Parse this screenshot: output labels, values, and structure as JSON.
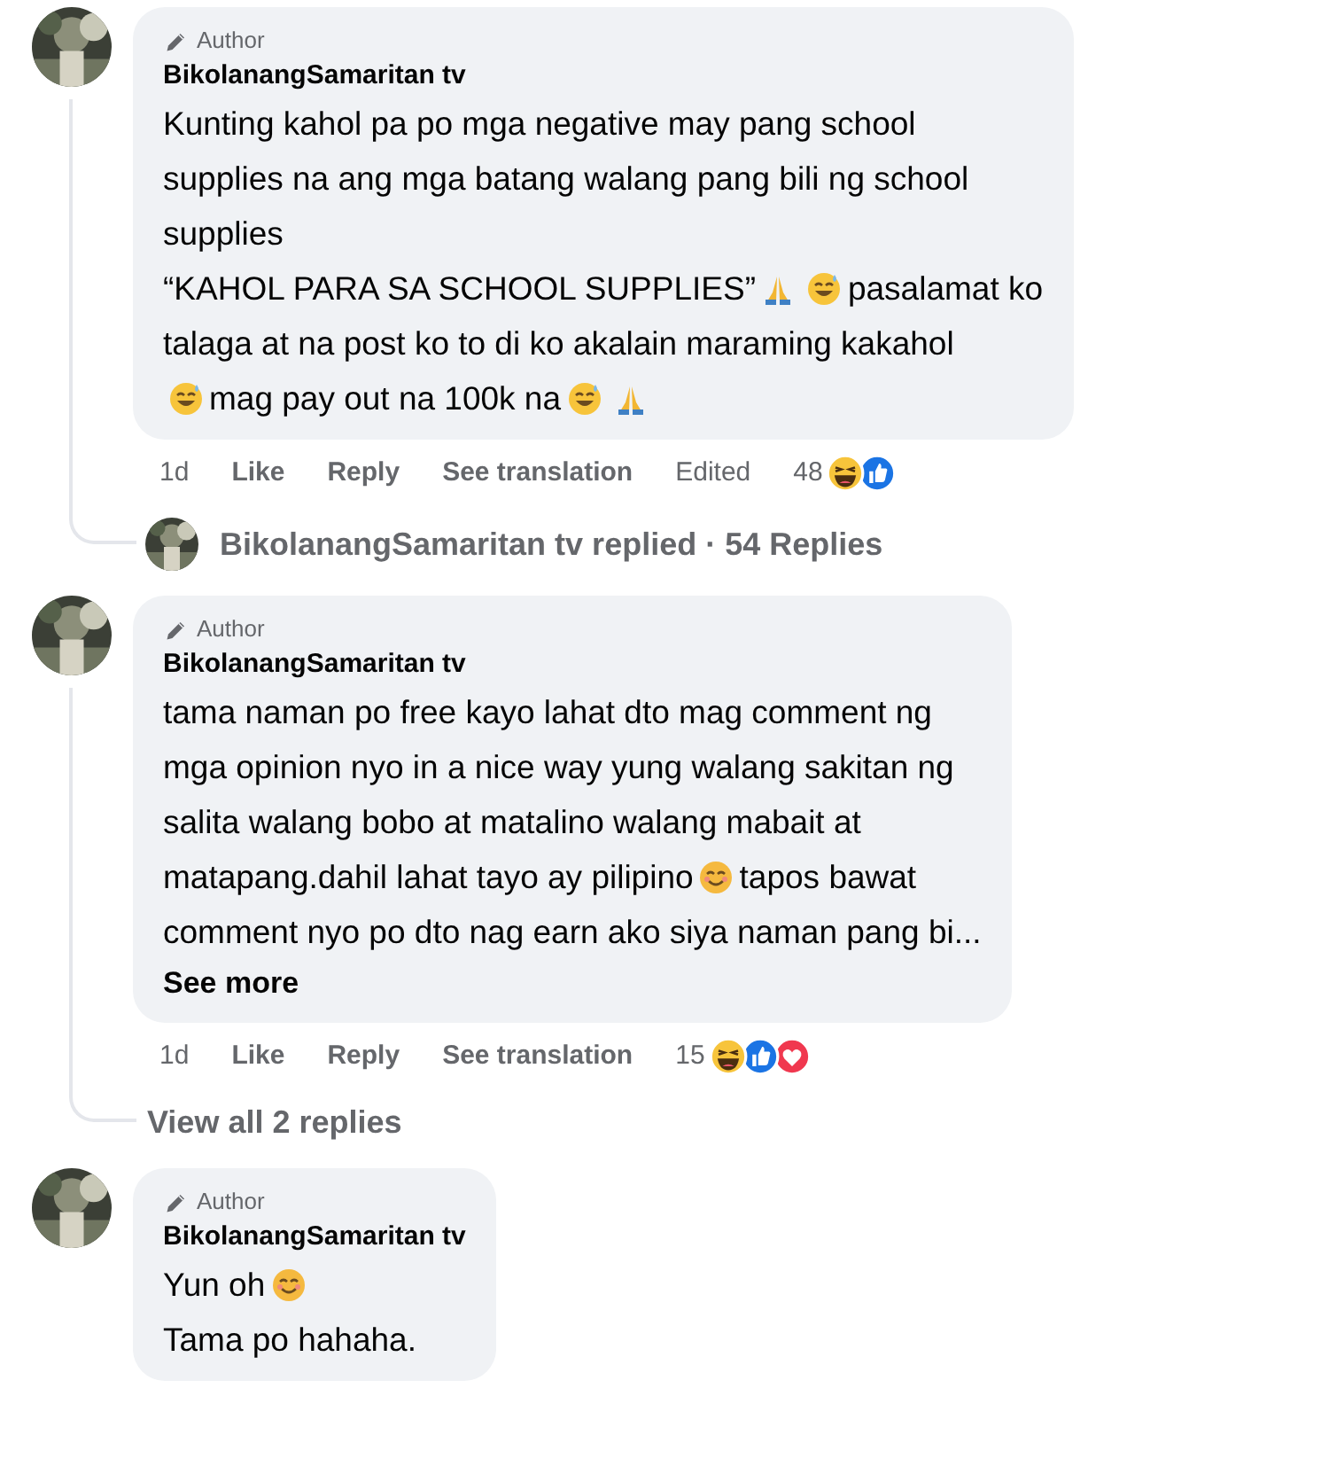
{
  "comments": [
    {
      "badge": "Author",
      "name": "BikolanangSamaritan tv",
      "lines": [
        [
          {
            "kind": "text",
            "text": "Kunting kahol pa po mga negative may pang school"
          }
        ],
        [
          {
            "kind": "text",
            "text": "supplies na ang mga batang walang pang bili ng school"
          }
        ],
        [
          {
            "kind": "text",
            "text": "supplies"
          }
        ],
        [
          {
            "kind": "text",
            "text": "“KAHOL PARA SA SCHOOL SUPPLIES”"
          },
          {
            "kind": "pray"
          },
          {
            "kind": "sweat-smile"
          },
          {
            "kind": "text",
            "text": "pasalamat ko"
          }
        ],
        [
          {
            "kind": "text",
            "text": "talaga at na post ko to di ko akalain maraming kakahol"
          }
        ],
        [
          {
            "kind": "sweat-smile"
          },
          {
            "kind": "text",
            "text": "mag pay out na 100k na"
          },
          {
            "kind": "sweat-smile"
          },
          {
            "kind": "pray"
          }
        ]
      ],
      "time": "1d",
      "actions": [
        "Like",
        "Reply",
        "See translation"
      ],
      "edited": "Edited",
      "reaction_count": "48",
      "reactions": [
        {
          "kind": "haha"
        },
        {
          "kind": "like"
        }
      ],
      "replies_summary": "BikolanangSamaritan tv replied · 54 Replies"
    },
    {
      "badge": "Author",
      "name": "BikolanangSamaritan tv",
      "lines": [
        [
          {
            "kind": "text",
            "text": "tama naman po free kayo lahat dto mag comment ng"
          }
        ],
        [
          {
            "kind": "text",
            "text": "mga opinion nyo in a nice way yung walang sakitan ng"
          }
        ],
        [
          {
            "kind": "text",
            "text": "salita walang bobo at matalino walang mabait at"
          }
        ],
        [
          {
            "kind": "text",
            "text": "matapang.dahil lahat tayo ay pilipino"
          },
          {
            "kind": "smile"
          },
          {
            "kind": "text",
            "text": "tapos bawat"
          }
        ],
        [
          {
            "kind": "text",
            "text": "comment nyo po dto nag earn ako siya naman pang bi..."
          }
        ]
      ],
      "see_more": "See more",
      "time": "1d",
      "actions": [
        "Like",
        "Reply",
        "See translation"
      ],
      "reaction_count": "15",
      "reactions": [
        {
          "kind": "haha"
        },
        {
          "kind": "like"
        },
        {
          "kind": "love"
        }
      ],
      "view_replies": "View all 2 replies"
    },
    {
      "badge": "Author",
      "name": "BikolanangSamaritan tv",
      "lines": [
        [
          {
            "kind": "text",
            "text": "Yun oh"
          },
          {
            "kind": "smile"
          }
        ],
        [
          {
            "kind": "text",
            "text": "Tama po hahaha."
          }
        ]
      ]
    }
  ]
}
